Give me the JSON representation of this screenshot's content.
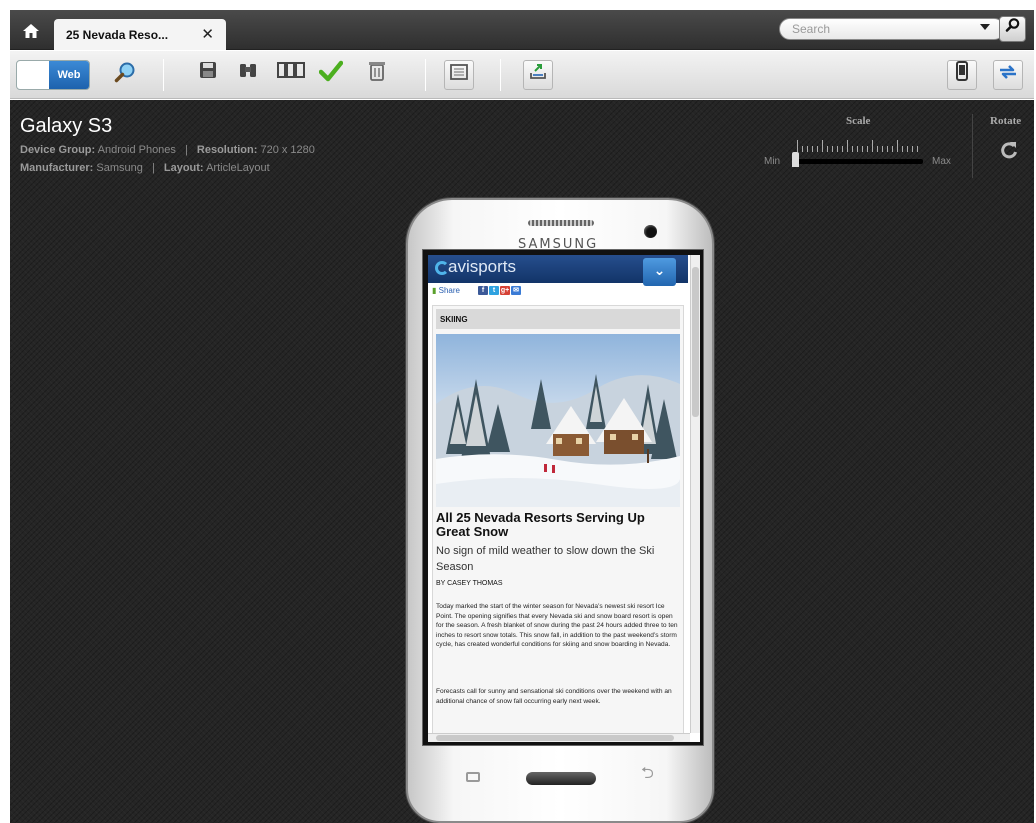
{
  "tab": {
    "title": "25 Nevada Reso...",
    "close": "✕"
  },
  "search": {
    "placeholder": "Search"
  },
  "toolbar": {
    "web_label": "Web"
  },
  "device": {
    "name": "Galaxy S3",
    "group_label": "Device Group:",
    "group_value": "Android Phones",
    "resolution_label": "Resolution:",
    "resolution_value": "720 x 1280",
    "manufacturer_label": "Manufacturer:",
    "manufacturer_value": "Samsung",
    "layout_label": "Layout:",
    "layout_value": "ArticleLayout",
    "separator": "|"
  },
  "scale": {
    "title": "Scale",
    "min": "Min",
    "max": "Max",
    "level": 0
  },
  "rotate": {
    "title": "Rotate"
  },
  "phone": {
    "brand": "SAMSUNG"
  },
  "site": {
    "logo": "avisports",
    "share_label": "Share",
    "share_icons": [
      "f",
      "t",
      "g+",
      "✉"
    ],
    "section": "SKIING",
    "headline": "All 25 Nevada Resorts Serving Up Great Snow",
    "subhead": "No sign of mild weather to slow down the Ski Season",
    "byline": "BY CASEY THOMAS",
    "paragraph1": "Today marked the start of the winter season for Nevada’s newest ski resort Ice Point. The opening signifies that every Nevada ski and snow board resort is open for the season. A fresh blanket of snow during the past 24 hours added three to ten inches to resort snow totals. This snow fall, in addition to the past weekend’s storm cycle, has created wonderful conditions for skiing and snow boarding in Nevada.",
    "paragraph2": "Forecasts call for sunny and sensational ski conditions over the weekend with an additional chance of snow fall occurring early next week."
  },
  "colors": {
    "accent_blue": "#1d62ad",
    "site_header": "#123468",
    "workspace": "#252525",
    "save_check": "#4caf1f"
  },
  "icons": {
    "home": "home-icon",
    "search_go": "search-icon",
    "preview": "magnifier-icon",
    "save": "floppy-disk-icon",
    "binoculars": "binoculars-icon",
    "layout": "layout-columns-icon",
    "approve": "checkmark-icon",
    "delete": "trash-icon",
    "frame": "frame-icon",
    "export": "export-icon",
    "device": "phone-device-icon",
    "sync": "sync-arrows-icon",
    "rotate": "rotate-icon"
  }
}
